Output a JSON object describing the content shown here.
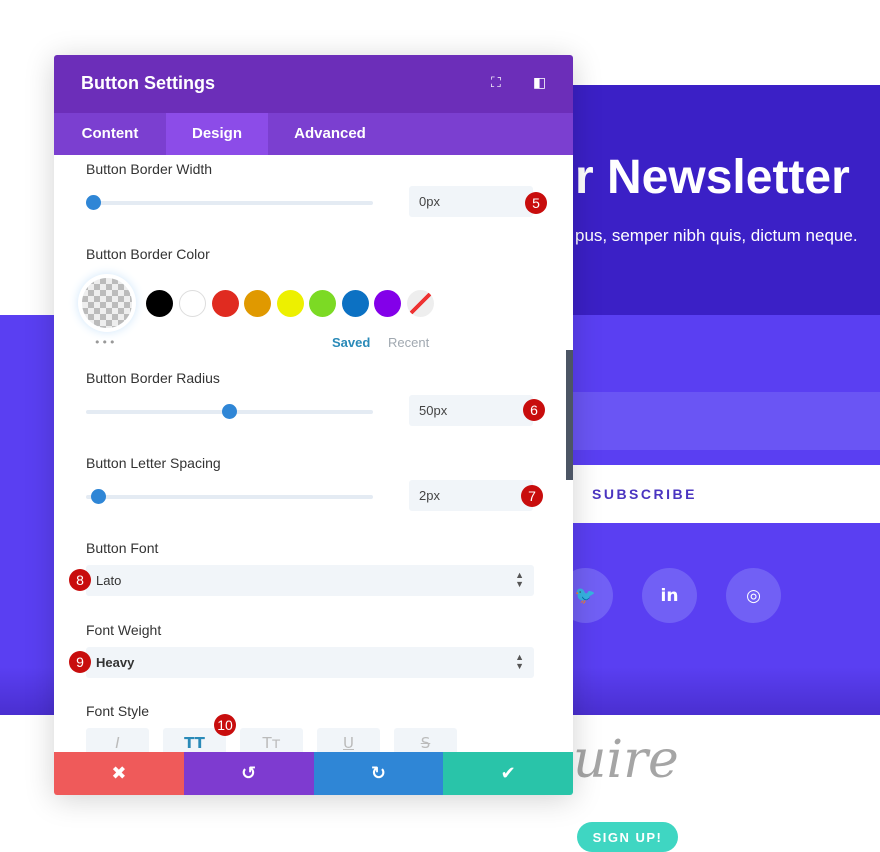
{
  "background": {
    "headline": "r Newsletter",
    "subtext": "pus, semper nibh quis, dictum neque.",
    "subscribe_label": "SUBSCRIBE",
    "social_icons": [
      "twitter-icon",
      "linkedin-icon",
      "instagram-icon"
    ],
    "script_logo": "uire",
    "signup_label": "SIGN UP!"
  },
  "modal": {
    "title": "Button Settings",
    "header_icons": [
      "expand-icon",
      "sidebar-layout-icon"
    ],
    "tabs": [
      {
        "label": "Content"
      },
      {
        "label": "Design",
        "active": true
      },
      {
        "label": "Advanced"
      }
    ],
    "border_width": {
      "label": "Button Border Width",
      "value": "0px",
      "slider_percent": 0,
      "badge": "5"
    },
    "border_color": {
      "label": "Button Border Color",
      "swatches": [
        "#000000",
        "#ffffff",
        "#e02b20",
        "#e09900",
        "#edf000",
        "#7cda24",
        "#0c71c3",
        "#8300e9"
      ],
      "saved_label": "Saved",
      "recent_label": "Recent",
      "more": "•••"
    },
    "border_radius": {
      "label": "Button Border Radius",
      "value": "50px",
      "slider_percent": 50,
      "badge": "6"
    },
    "letter_spacing": {
      "label": "Button Letter Spacing",
      "value": "2px",
      "slider_percent": 4,
      "badge": "7"
    },
    "font": {
      "label": "Button Font",
      "value": "Lato",
      "badge": "8"
    },
    "font_weight": {
      "label": "Font Weight",
      "value": "Heavy",
      "badge": "9"
    },
    "font_style": {
      "label": "Font Style",
      "badge": "10",
      "options": [
        "I",
        "TT",
        "Tт",
        "U",
        "S"
      ],
      "active": "TT"
    },
    "footer": {
      "cancel": "✖",
      "undo": "↺",
      "redo": "↻",
      "save": "✔"
    },
    "colors": {
      "header": "#6c2eb9",
      "tabs": "#7b3fd0",
      "cancel": "#ef5a5a",
      "undo": "#7e3bd0",
      "redo": "#2f86d6",
      "save": "#29c4a9"
    }
  }
}
